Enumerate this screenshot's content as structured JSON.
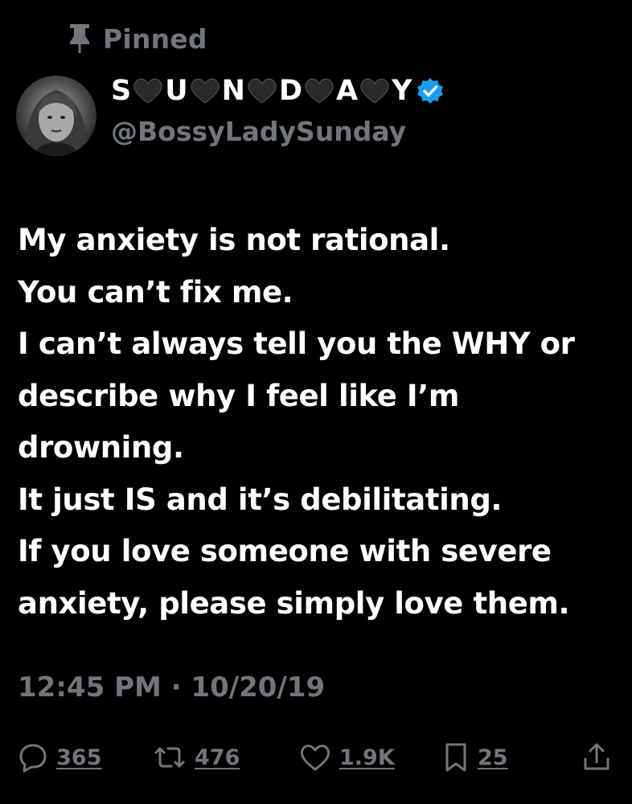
{
  "pinned": {
    "label": "Pinned",
    "icon": "pin-icon"
  },
  "author": {
    "name_letters": [
      "S",
      "U",
      "N",
      "D",
      "A",
      "Y"
    ],
    "name_separator_icon": "black-heart-icon",
    "verified_icon": "verified-badge-icon",
    "handle": "@BossyLadySunday",
    "avatar": "avatar"
  },
  "tweet": {
    "lines": [
      "My anxiety is not rational.",
      "You can’t fix me.",
      "I can’t always tell you the WHY or",
      "describe why I feel like I’m",
      "drowning.",
      "It just IS and it’s debilitating.",
      "If you love someone with severe",
      "anxiety, please simply love them."
    ],
    "timestamp": "12:45 PM · 10/20/19"
  },
  "actions": {
    "reply": {
      "icon": "reply-icon",
      "count": "365"
    },
    "repost": {
      "icon": "repost-icon",
      "count": "476"
    },
    "like": {
      "icon": "heart-icon",
      "count": "1.9K"
    },
    "bookmark": {
      "icon": "bookmark-icon",
      "count": "25"
    },
    "share": {
      "icon": "share-icon"
    }
  },
  "colors": {
    "background": "#000000",
    "text": "#ffffff",
    "secondary": "#71767b",
    "verified": "#1d9bf0"
  }
}
